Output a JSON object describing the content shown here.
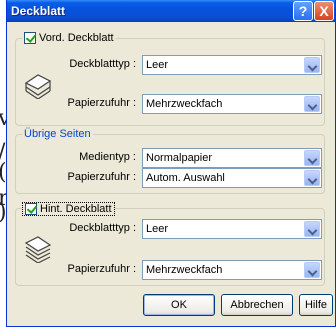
{
  "window": {
    "title": "Deckblatt",
    "help_glyph": "?",
    "close_glyph": "X"
  },
  "edge_glyphs": [
    "v",
    "/",
    "(",
    "r",
    ")"
  ],
  "front_cover": {
    "checkbox_label": "Vord. Deckblatt",
    "checked": true,
    "type_label": "Deckblatttyp :",
    "type_value": "Leer",
    "feed_label": "Papierzufuhr :",
    "feed_value": "Mehrzweckfach"
  },
  "other_pages": {
    "legend": "Übrige Seiten",
    "media_label": "Medientyp :",
    "media_value": "Normalpapier",
    "feed_label": "Papierzufuhr :",
    "feed_value": "Autom. Auswahl"
  },
  "back_cover": {
    "checkbox_label": "Hint. Deckblatt",
    "checked": true,
    "type_label": "Deckblatttyp :",
    "type_value": "Leer",
    "feed_label": "Papierzufuhr :",
    "feed_value": "Mehrzweckfach"
  },
  "buttons": {
    "ok": "OK",
    "cancel": "Abbrechen",
    "help": "Hilfe"
  }
}
